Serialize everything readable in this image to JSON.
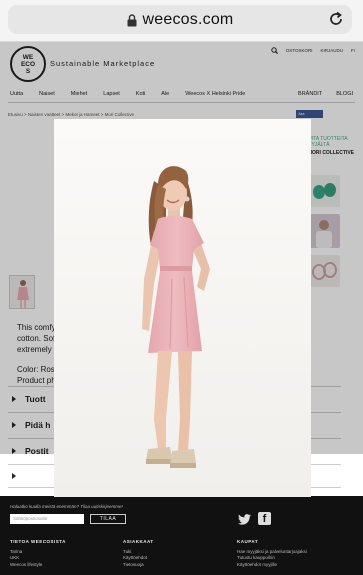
{
  "browser": {
    "url": "weecos.com"
  },
  "header": {
    "logo_text": "WE\nECO\nS",
    "tagline": "Sustainable Marketplace",
    "top_links": [
      "OSTOSKORI",
      "KIRJAUDU",
      "FI"
    ]
  },
  "nav": {
    "items": [
      "Uutta",
      "Naiset",
      "Miehet",
      "Lapset",
      "Koti",
      "Ale",
      "Weecos X Helsinki Pride"
    ],
    "right": [
      "BRÄNDIT",
      "BLOGI"
    ]
  },
  "breadcrumb": "Etusivu  >  Naisten vaatteet  >  Mekot ja Hameet  >  Mori Collective",
  "share_label": "Jaa",
  "right_column": {
    "title": "MUITA TUOTTEITA MYYJÄLTÄ",
    "brand": "MORI COLLECTIVE"
  },
  "description": {
    "line1": "This comfy",
    "line2": "cotton. Sof",
    "line3": "extremely s",
    "color_line": "Color: Ros",
    "photo_line": "Product ph"
  },
  "accordion": [
    "Tuott",
    "Pidä h",
    "Postit",
    ""
  ],
  "footer": {
    "newsletter_question": "Haluatko kuulla meistä enemmän? Tilaa uutiskirjeemme!",
    "email_placeholder": "Sähköpostiosoite",
    "subscribe_label": "TILAA",
    "columns": [
      {
        "title": "TIETOA WEECOSISTA",
        "links": [
          "Tarina",
          "UKK",
          "Weecos lifestyle"
        ]
      },
      {
        "title": "ASIAKKAAT",
        "links": [
          "Tuki",
          "Käyttöehdot",
          "Tietosuoja"
        ]
      },
      {
        "title": "KAUPAT",
        "links": [
          "Hae myyjäksi ja palveluntarjoajaksi",
          "Tutustu kauppoihin",
          "Käyttöehdot myyjille"
        ]
      }
    ]
  },
  "colors": {
    "dress": "#eab3b8",
    "footer_bg": "#111111",
    "accent_green": "#44aa88"
  }
}
